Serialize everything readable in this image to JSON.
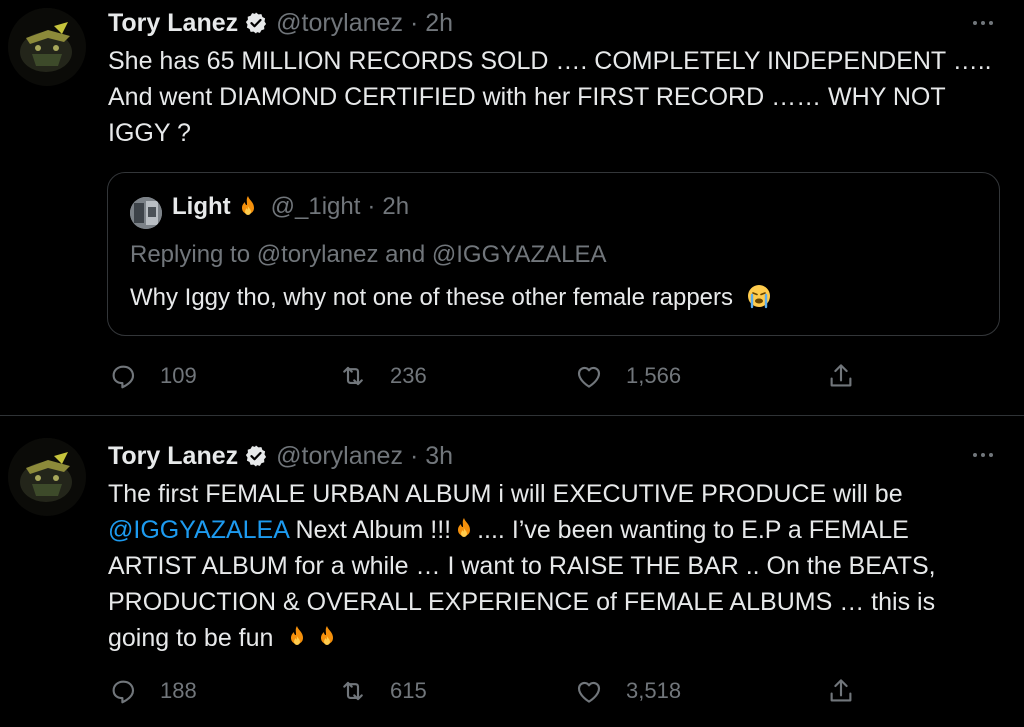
{
  "tweets": [
    {
      "author_name": "Tory Lanez",
      "handle": "@torylanez",
      "separator": "·",
      "time": "2h",
      "text_lines": [
        "She has 65 MILLION RECORDS SOLD …. COMPLETELY INDEPENDENT …..",
        "And went DIAMOND CERTIFIED with her FIRST RECORD …… WHY NOT",
        "IGGY ?"
      ],
      "quote": {
        "author_name": "Light",
        "handle": "@_1ight",
        "separator": "·",
        "time": "2h",
        "replying": "Replying to @torylanez and @IGGYAZALEA",
        "text": "Why Iggy tho, why not one of these other female rappers"
      },
      "stats": {
        "replies": "109",
        "retweets": "236",
        "likes": "1,566"
      }
    },
    {
      "author_name": "Tory Lanez",
      "handle": "@torylanez",
      "separator": "·",
      "time": "3h",
      "text_line1": "The first FEMALE URBAN ALBUM  i will EXECUTIVE PRODUCE will be",
      "mention": "@IGGYAZALEA",
      "line2_mid": " Next Album !!!",
      "line2_end": ".... I’ve been wanting to E.P a FEMALE",
      "text_line3": "ARTIST ALBUM for a while …  I want to RAISE THE BAR .. On the BEATS,",
      "text_line4": "PRODUCTION & OVERALL EXPERIENCE of FEMALE ALBUMS … this is",
      "text_line5": "going to be fun ",
      "stats": {
        "replies": "188",
        "retweets": "615",
        "likes": "3,518"
      }
    }
  ],
  "colors": {
    "background": "#000000",
    "text": "#e7e9ea",
    "muted": "#71767b",
    "link": "#1d9bf0",
    "verified": "#e7e9ea",
    "border": "#333639"
  },
  "icons": [
    "verified-badge-icon",
    "more-icon",
    "reply-icon",
    "retweet-icon",
    "like-icon",
    "share-icon",
    "fire-emoji",
    "crying-emoji"
  ]
}
